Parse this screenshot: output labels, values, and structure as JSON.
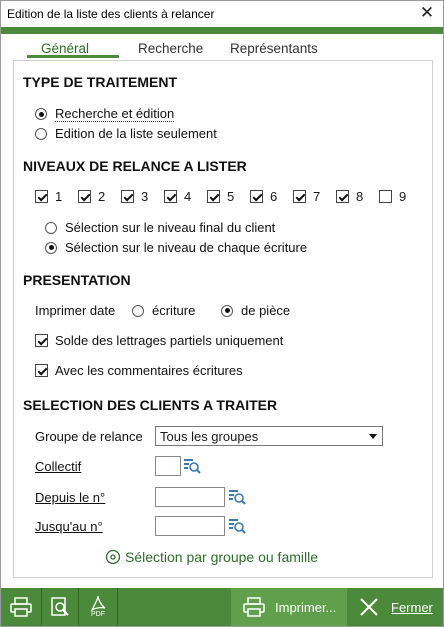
{
  "window": {
    "title": "Edition de la liste des clients à relancer",
    "close_glyph": "✕"
  },
  "tabs": [
    {
      "label": "Général"
    },
    {
      "label": "Recherche"
    },
    {
      "label": "Représentants"
    }
  ],
  "traitement": {
    "heading": "TYPE DE TRAITEMENT",
    "options": [
      {
        "label": "Recherche et édition",
        "selected": true
      },
      {
        "label": "Edition de la liste seulement",
        "selected": false
      }
    ]
  },
  "niveaux": {
    "heading": "NIVEAUX DE RELANCE A LISTER",
    "levels": [
      {
        "label": "1",
        "checked": true
      },
      {
        "label": "2",
        "checked": true
      },
      {
        "label": "3",
        "checked": true
      },
      {
        "label": "4",
        "checked": true
      },
      {
        "label": "5",
        "checked": true
      },
      {
        "label": "6",
        "checked": true
      },
      {
        "label": "7",
        "checked": true
      },
      {
        "label": "8",
        "checked": true
      },
      {
        "label": "9",
        "checked": false
      }
    ],
    "options": [
      {
        "label": "Sélection sur le niveau final du client",
        "selected": false
      },
      {
        "label": "Sélection sur le niveau de chaque écriture",
        "selected": true
      }
    ]
  },
  "presentation": {
    "heading": "PRESENTATION",
    "imprimer_date_label": "Imprimer date",
    "date_options": [
      {
        "label": "écriture",
        "selected": false
      },
      {
        "label": "de pièce",
        "selected": true
      }
    ],
    "solde_label": "Solde des lettrages partiels uniquement",
    "solde_checked": true,
    "commentaires_label": "Avec les commentaires écritures",
    "commentaires_checked": true
  },
  "selection": {
    "heading": "SELECTION DES CLIENTS A TRAITER",
    "groupe_label": "Groupe de relance",
    "groupe_value": "Tous les groupes",
    "collectif_label": "Collectif",
    "collectif_value": "",
    "depuis_label": "Depuis le n°",
    "depuis_value": "",
    "jusqu_label": "Jusqu'au n°",
    "jusqu_value": "",
    "groupe_famille_link": "Sélection par groupe ou famille"
  },
  "footer": {
    "print_label": "Imprimer...",
    "close_label": "Fermer",
    "pdf_text": "PDF"
  },
  "colors": {
    "accent": "#4a8a3a",
    "accent_light": "#60a04c",
    "tab_active": "#2e6e2a"
  }
}
